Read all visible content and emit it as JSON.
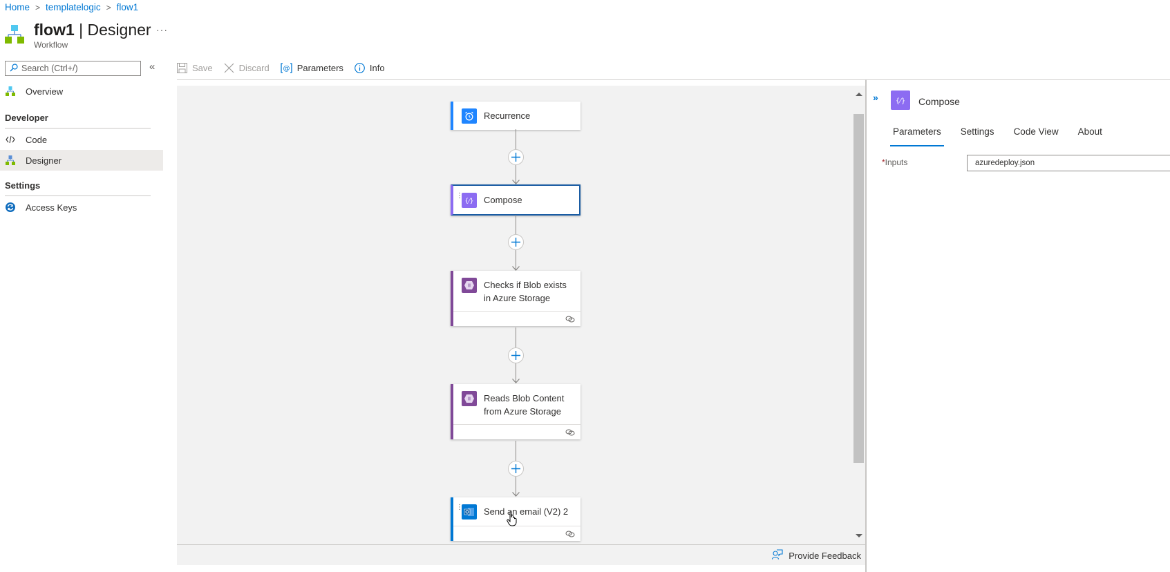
{
  "breadcrumb": [
    {
      "label": "Home"
    },
    {
      "label": "templatelogic"
    },
    {
      "label": "flow1"
    }
  ],
  "header": {
    "title_bold": "flow1",
    "title_rest": " | Designer",
    "subtitle": "Workflow",
    "more_label": "···",
    "icon": "workflow-icon"
  },
  "sidebar": {
    "search_placeholder": "Search (Ctrl+/)",
    "collapse_label": "«",
    "items": [
      {
        "label": "Overview",
        "icon": "workflow-icon"
      },
      {
        "label": "Code",
        "icon": "code-icon"
      },
      {
        "label": "Designer",
        "icon": "workflow-icon",
        "active": true
      },
      {
        "label": "Access Keys",
        "icon": "refresh-icon"
      }
    ],
    "sections": [
      {
        "label": "Developer"
      },
      {
        "label": "Settings"
      }
    ]
  },
  "toolbar": {
    "save_label": "Save",
    "discard_label": "Discard",
    "parameters_label": "Parameters",
    "info_label": "Info"
  },
  "flow": {
    "steps": [
      {
        "label": "Recurrence",
        "icon": "alarm-clock-icon",
        "color": "#1f85ff"
      },
      {
        "label": "Compose",
        "icon": "compose-icon",
        "color": "#8c6cf2",
        "selected": true
      },
      {
        "label": "Checks if Blob exists in Azure Storage",
        "icon": "blob-storage-icon",
        "color": "#804998"
      },
      {
        "label": "Reads Blob Content from Azure Storage",
        "icon": "blob-storage-icon",
        "color": "#804998"
      },
      {
        "label": "Send an email (V2) 2",
        "icon": "outlook-icon",
        "color": "#0078d4"
      }
    ]
  },
  "footer": {
    "feedback_label": "Provide Feedback"
  },
  "panel": {
    "title": "Compose",
    "expand_label": "»",
    "tabs": [
      {
        "label": "Parameters",
        "active": true
      },
      {
        "label": "Settings"
      },
      {
        "label": "Code View"
      },
      {
        "label": "About"
      }
    ],
    "field_required_mark": "*",
    "field_label": "Inputs",
    "field_value": "azuredeploy.json"
  },
  "colors": {
    "accent": "#0078d4",
    "compose": "#8c6cf2",
    "storage": "#804998",
    "recurrence": "#1f85ff"
  }
}
